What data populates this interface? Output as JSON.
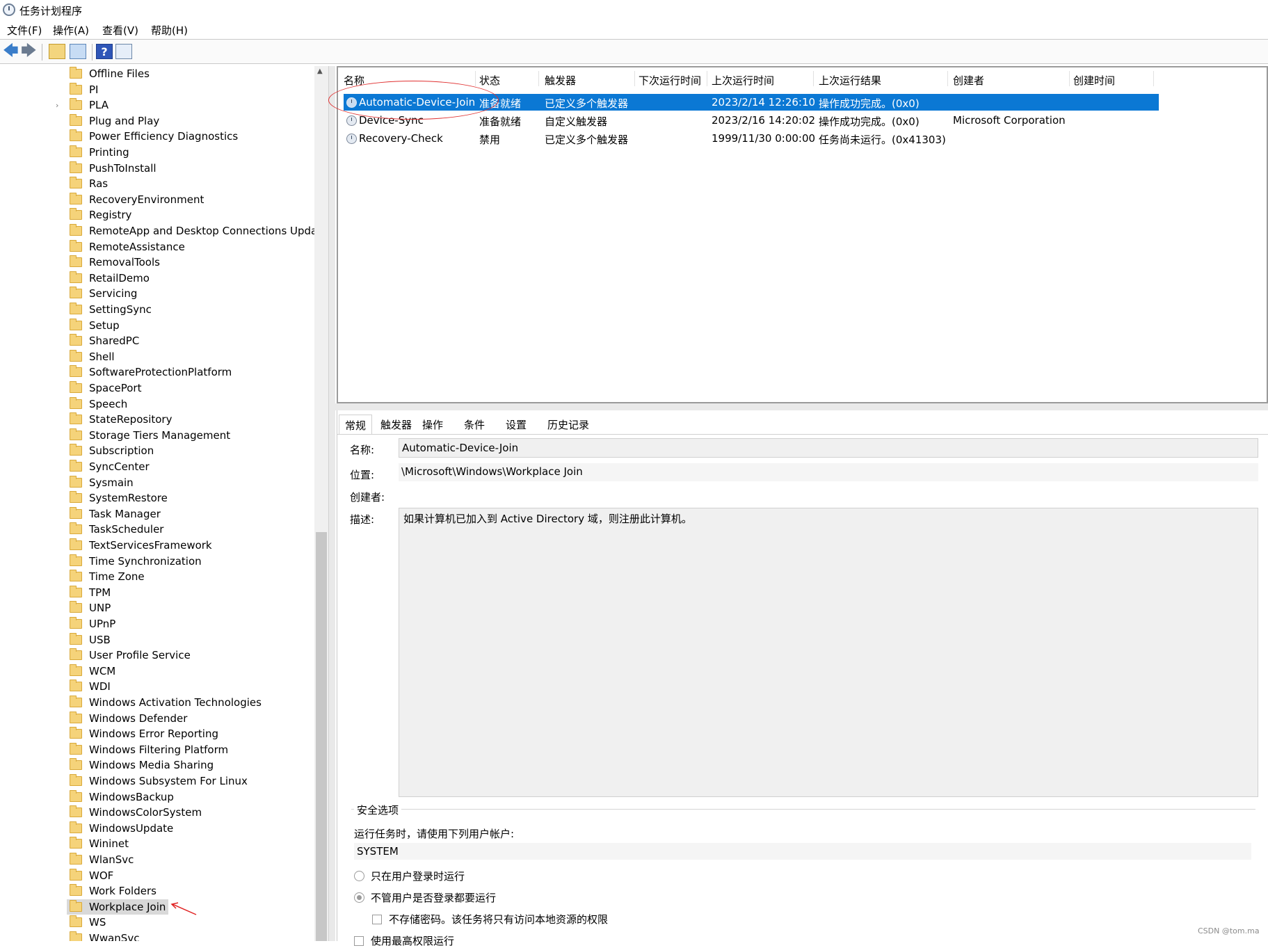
{
  "window": {
    "title": "任务计划程序"
  },
  "menu": [
    "文件(F)",
    "操作(A)",
    "查看(V)",
    "帮助(H)"
  ],
  "toolbar": {
    "icons": [
      "back-arrow-icon",
      "forward-arrow-icon",
      "folder-up-icon",
      "show-hide-console-tree-icon",
      "help-icon",
      "action-pane-icon"
    ]
  },
  "tree": {
    "items": [
      "Offline Files",
      "PI",
      "PLA",
      "Plug and Play",
      "Power Efficiency Diagnostics",
      "Printing",
      "PushToInstall",
      "Ras",
      "RecoveryEnvironment",
      "Registry",
      "RemoteApp and Desktop Connections Update",
      "RemoteAssistance",
      "RemovalTools",
      "RetailDemo",
      "Servicing",
      "SettingSync",
      "Setup",
      "SharedPC",
      "Shell",
      "SoftwareProtectionPlatform",
      "SpacePort",
      "Speech",
      "StateRepository",
      "Storage Tiers Management",
      "Subscription",
      "SyncCenter",
      "Sysmain",
      "SystemRestore",
      "Task Manager",
      "TaskScheduler",
      "TextServicesFramework",
      "Time Synchronization",
      "Time Zone",
      "TPM",
      "UNP",
      "UPnP",
      "USB",
      "User Profile Service",
      "WCM",
      "WDI",
      "Windows Activation Technologies",
      "Windows Defender",
      "Windows Error Reporting",
      "Windows Filtering Platform",
      "Windows Media Sharing",
      "Windows Subsystem For Linux",
      "WindowsBackup",
      "WindowsColorSystem",
      "WindowsUpdate",
      "Wininet",
      "WlanSvc",
      "WOF",
      "Work Folders",
      "Workplace Join",
      "WS",
      "WwanSvc"
    ],
    "selected": "Workplace Join",
    "expandable": "PLA"
  },
  "tasks": {
    "columns": [
      "名称",
      "状态",
      "触发器",
      "下次运行时间",
      "上次运行时间",
      "上次运行结果",
      "创建者",
      "创建时间"
    ],
    "rows": [
      {
        "name": "Automatic-Device-Join",
        "status": "准备就绪",
        "trigger": "已定义多个触发器",
        "next_run": "",
        "last_run": "2023/2/14 12:26:10",
        "last_result": "操作成功完成。(0x0)",
        "author": "",
        "created": ""
      },
      {
        "name": "Device-Sync",
        "status": "准备就绪",
        "trigger": "自定义触发器",
        "next_run": "",
        "last_run": "2023/2/16 14:20:02",
        "last_result": "操作成功完成。(0x0)",
        "author": "Microsoft Corporation",
        "created": ""
      },
      {
        "name": "Recovery-Check",
        "status": "禁用",
        "trigger": "已定义多个触发器",
        "next_run": "",
        "last_run": "1999/11/30 0:00:00",
        "last_result": "任务尚未运行。(0x41303)",
        "author": "",
        "created": ""
      }
    ]
  },
  "details": {
    "tabs": [
      "常规",
      "触发器",
      "操作",
      "条件",
      "设置",
      "历史记录"
    ],
    "active_tab": "常规",
    "name_label": "名称:",
    "name_value": "Automatic-Device-Join",
    "location_label": "位置:",
    "location_value": "\\Microsoft\\Windows\\Workplace Join",
    "author_label": "创建者:",
    "description_label": "描述:",
    "description_value": "如果计算机已加入到 Active Directory 域，则注册此计算机。",
    "security": {
      "group_label": "安全选项",
      "run_as_prompt": "运行任务时，请使用下列用户帐户:",
      "account": "SYSTEM",
      "option_logged_on": "只在用户登录时运行",
      "option_whether_logged": "不管用户是否登录都要运行",
      "option_no_store_password": "不存储密码。该任务将只有访问本地资源的权限",
      "option_highest": "使用最高权限运行"
    }
  },
  "watermark": "CSDN @tom.ma"
}
